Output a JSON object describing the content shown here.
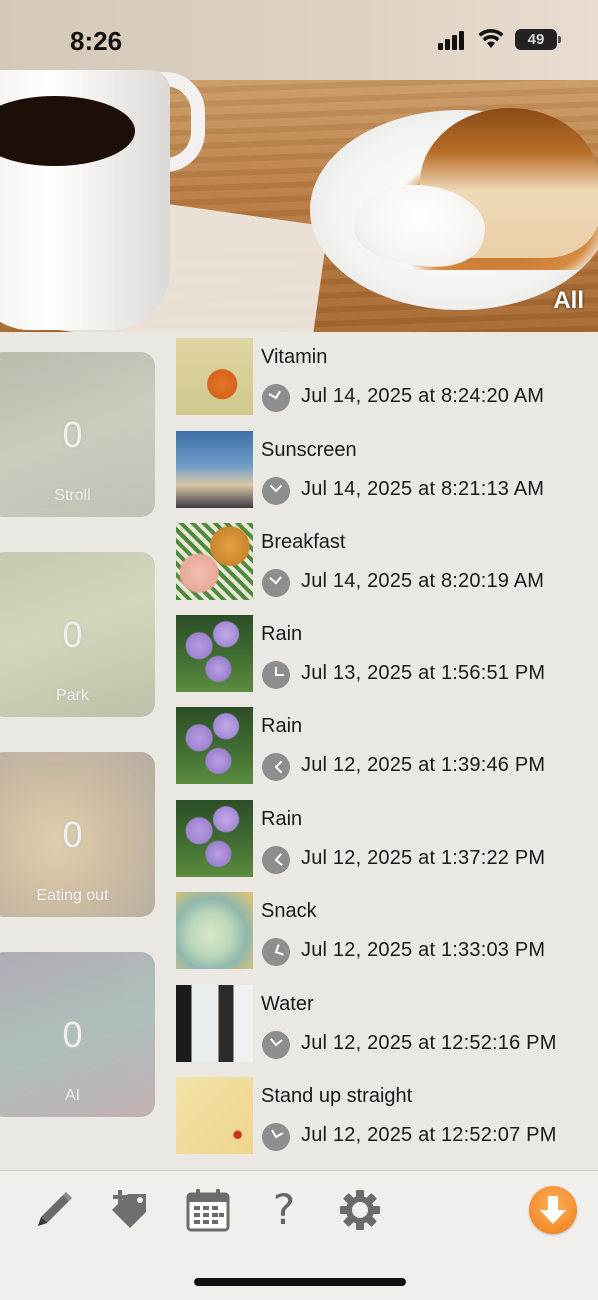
{
  "status_bar": {
    "time": "8:26",
    "battery": "49"
  },
  "header": {
    "filter_label": "All"
  },
  "categories": [
    {
      "count": "0",
      "name": "Stroll"
    },
    {
      "count": "0",
      "name": "Park"
    },
    {
      "count": "0",
      "name": "Eating out"
    },
    {
      "count": "0",
      "name": "AI"
    }
  ],
  "entries": [
    {
      "name": "Vitamin",
      "datetime": "Jul 14, 2025 at 8:24:20 AM",
      "thumb": "vitamin"
    },
    {
      "name": "Sunscreen",
      "datetime": "Jul 14, 2025 at 8:21:13 AM",
      "thumb": "sunscreen"
    },
    {
      "name": "Breakfast",
      "datetime": "Jul 14, 2025 at 8:20:19 AM",
      "thumb": "breakfast"
    },
    {
      "name": "Rain",
      "datetime": "Jul 13, 2025 at 1:56:51 PM",
      "thumb": "rain"
    },
    {
      "name": "Rain",
      "datetime": "Jul 12, 2025 at 1:39:46 PM",
      "thumb": "rain"
    },
    {
      "name": "Rain",
      "datetime": "Jul 12, 2025 at 1:37:22 PM",
      "thumb": "rain"
    },
    {
      "name": "Snack",
      "datetime": "Jul 12, 2025 at 1:33:03 PM",
      "thumb": "snack"
    },
    {
      "name": "Water",
      "datetime": "Jul 12, 2025 at 12:52:16 PM",
      "thumb": "water"
    },
    {
      "name": "Stand up straight",
      "datetime": "Jul 12, 2025 at 12:52:07 PM",
      "thumb": "stand"
    }
  ],
  "toolbar": {
    "icons": [
      "pencil-icon",
      "add-tag-icon",
      "calendar-icon",
      "help-icon",
      "settings-gear-icon",
      "download-arrow-icon"
    ],
    "help_glyph": "?",
    "accent_color": "#f28c2c"
  }
}
